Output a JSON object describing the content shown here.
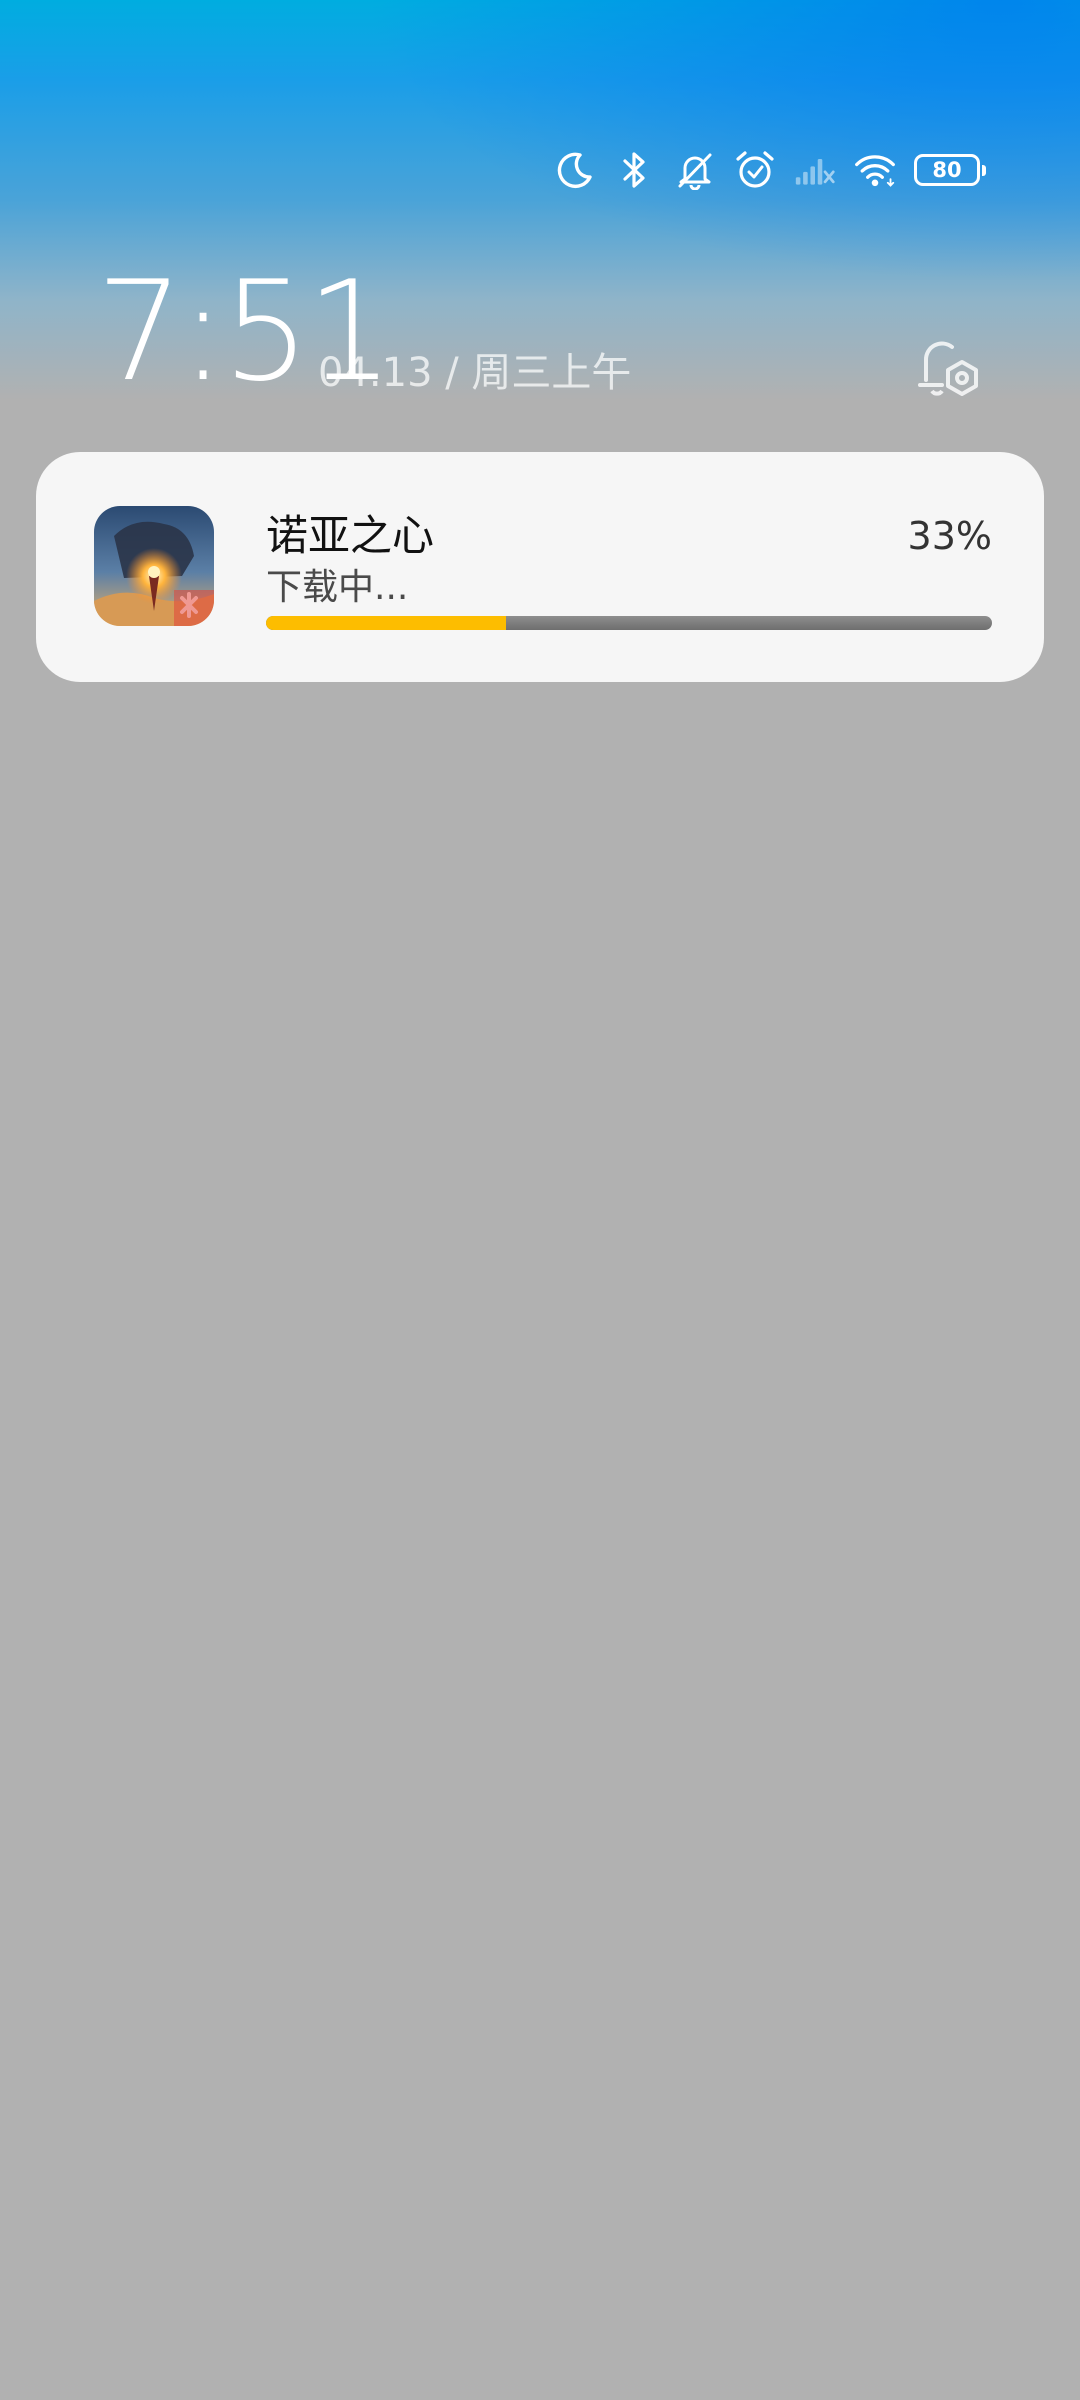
{
  "status_bar": {
    "icons": [
      "moon-icon",
      "bluetooth-icon",
      "bell-off-icon",
      "alarm-icon",
      "signal-no-service-icon",
      "wifi-icon"
    ],
    "battery_level": "80"
  },
  "lock_screen": {
    "time": "7:51",
    "date": "04.13 / 周三上午",
    "notification_settings_icon": "bell-gear-icon"
  },
  "notification": {
    "app_name": "诺亚之心",
    "status": "下载中...",
    "percent_label": "33%",
    "progress": 0.33,
    "colors": {
      "progress_fill": "#fdbd00",
      "progress_track": "#7a7a7a",
      "card_background": "#f6f6f6"
    }
  }
}
